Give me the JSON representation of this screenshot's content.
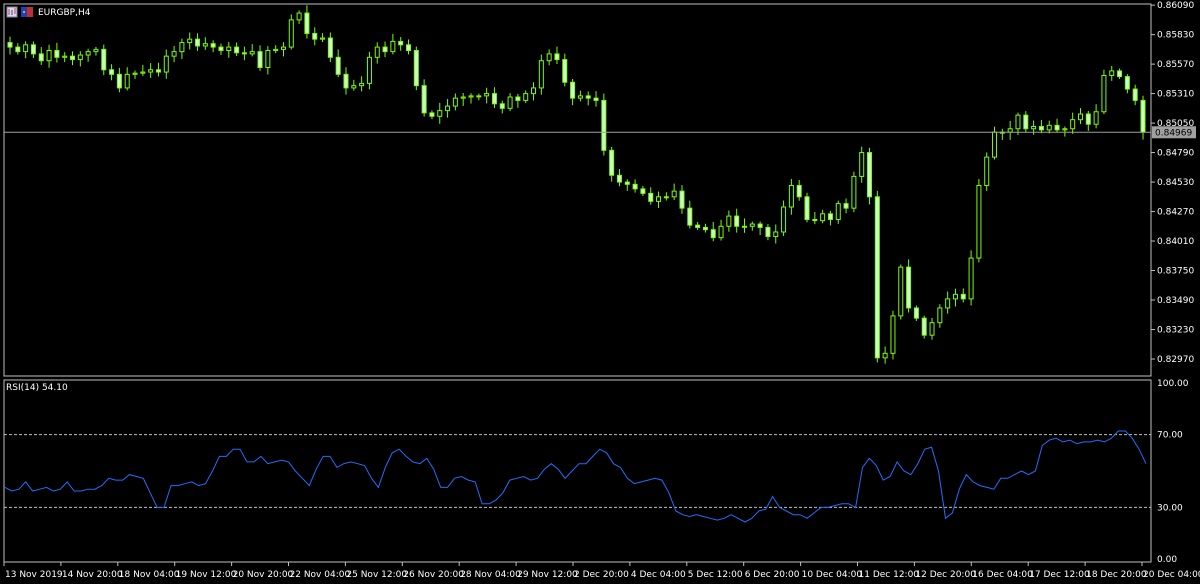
{
  "window": {
    "title": "EURGBP,H4",
    "icons": [
      "chart-window-icon",
      "eu-flag-icon"
    ]
  },
  "colors": {
    "background": "#000000",
    "frame": "#c0c0c0",
    "candle": "#7cfc00",
    "candle_body": "#ccffcc",
    "bid_line": "#a0a0a0",
    "rsi_line": "#1e6fff",
    "level_line": "#c0c0c0"
  },
  "chart_data": [
    {
      "type": "candlestick",
      "symbol": "EURGBP",
      "timeframe": "H4",
      "ylim": [
        0.8282,
        0.861
      ],
      "y_ticks": [
        "0.86090",
        "0.85830",
        "0.85570",
        "0.85310",
        "0.85050",
        "0.84790",
        "0.84530",
        "0.84270",
        "0.84010",
        "0.83750",
        "0.83490",
        "0.83230",
        "0.82970"
      ],
      "y_tick_values": [
        0.8609,
        0.8583,
        0.8557,
        0.8531,
        0.8505,
        0.8479,
        0.8453,
        0.8427,
        0.8401,
        0.8375,
        0.8349,
        0.8323,
        0.8297
      ],
      "current_price": 0.84969,
      "current_price_label": "0.84969",
      "close": [
        0.8572,
        0.8568,
        0.8574,
        0.8566,
        0.856,
        0.8569,
        0.8563,
        0.8564,
        0.8561,
        0.8565,
        0.8568,
        0.857,
        0.8552,
        0.8548,
        0.8536,
        0.8548,
        0.8549,
        0.855,
        0.8552,
        0.855,
        0.8564,
        0.8568,
        0.8576,
        0.8579,
        0.8573,
        0.8575,
        0.8572,
        0.8569,
        0.8572,
        0.8567,
        0.8566,
        0.8568,
        0.8554,
        0.8569,
        0.857,
        0.8572,
        0.8596,
        0.8602,
        0.8584,
        0.8579,
        0.858,
        0.8563,
        0.8548,
        0.8536,
        0.8538,
        0.854,
        0.8563,
        0.8572,
        0.8568,
        0.8577,
        0.8574,
        0.8569,
        0.8538,
        0.8514,
        0.8511,
        0.8516,
        0.852,
        0.8527,
        0.8528,
        0.8529,
        0.8529,
        0.8531,
        0.8522,
        0.8518,
        0.8528,
        0.8525,
        0.8531,
        0.8536,
        0.856,
        0.8566,
        0.8561,
        0.8541,
        0.8527,
        0.8529,
        0.8527,
        0.8525,
        0.8481,
        0.8459,
        0.8453,
        0.8451,
        0.8447,
        0.8443,
        0.8436,
        0.844,
        0.844,
        0.8445,
        0.843,
        0.8415,
        0.8413,
        0.8411,
        0.8404,
        0.8414,
        0.8423,
        0.8414,
        0.8414,
        0.8416,
        0.8413,
        0.8405,
        0.8409,
        0.8431,
        0.845,
        0.844,
        0.842,
        0.8419,
        0.8425,
        0.842,
        0.8434,
        0.843,
        0.8458,
        0.8479,
        0.844,
        0.8298,
        0.8302,
        0.8335,
        0.8378,
        0.8342,
        0.8333,
        0.8318,
        0.8329,
        0.8342,
        0.835,
        0.8354,
        0.835,
        0.8386,
        0.845,
        0.8475,
        0.8497,
        0.8497,
        0.85,
        0.8512,
        0.85,
        0.8502,
        0.8499,
        0.8503,
        0.8499,
        0.85,
        0.8508,
        0.8513,
        0.8504,
        0.8515,
        0.8547,
        0.8551,
        0.8546,
        0.8535,
        0.8525,
        0.8497
      ]
    },
    {
      "type": "line",
      "title": "RSI(14) 54.10",
      "ylim": [
        0,
        100
      ],
      "y_ticks": [
        "100.00",
        "70.00",
        "30.00",
        "0.00"
      ],
      "y_tick_values": [
        100,
        70,
        30,
        0
      ],
      "levels": [
        70,
        30
      ],
      "series": [
        {
          "name": "RSI(14)",
          "values": [
            41,
            39,
            40,
            44,
            39,
            40,
            41,
            39,
            40,
            44,
            39,
            39,
            40,
            40,
            42,
            46,
            45,
            45,
            48,
            47,
            46,
            38,
            30,
            30,
            42,
            42,
            43,
            44,
            42,
            43,
            50,
            58,
            58,
            62,
            62,
            55,
            55,
            58,
            54,
            55,
            56,
            55,
            50,
            46,
            42,
            51,
            58,
            58,
            52,
            54,
            55,
            54,
            53,
            46,
            41,
            52,
            60,
            62,
            58,
            55,
            54,
            57,
            51,
            41,
            41,
            46,
            47,
            45,
            44,
            32,
            32,
            34,
            38,
            45,
            46,
            47,
            45,
            46,
            51,
            54,
            51,
            46,
            50,
            54,
            54,
            58,
            62,
            60,
            54,
            52,
            46,
            43,
            44,
            45,
            46,
            45,
            38,
            28,
            26,
            25,
            26,
            25,
            24,
            23,
            24,
            26,
            24,
            22,
            24,
            28,
            29,
            36,
            30,
            28,
            26,
            26,
            24,
            27,
            30,
            30,
            31,
            32,
            32,
            30,
            52,
            57,
            53,
            45,
            47,
            55,
            50,
            48,
            54,
            62,
            63,
            50,
            24,
            27,
            40,
            48,
            44,
            42,
            41,
            40,
            46,
            46,
            48,
            50,
            48,
            50,
            64,
            67,
            68,
            66,
            67,
            65,
            66,
            66,
            67,
            66,
            68,
            72,
            72,
            68,
            62,
            54
          ]
        }
      ]
    }
  ],
  "x_axis": {
    "labels": [
      "13 Nov 2019",
      "14 Nov 20:00",
      "18 Nov 04:00",
      "19 Nov 12:00",
      "20 Nov 20:00",
      "22 Nov 04:00",
      "25 Nov 12:00",
      "26 Nov 20:00",
      "28 Nov 04:00",
      "29 Nov 12:00",
      "2 Dec 20:00",
      "4 Dec 04:00",
      "5 Dec 12:00",
      "6 Dec 20:00",
      "10 Dec 04:00",
      "11 Dec 12:00",
      "12 Dec 20:00",
      "16 Dec 04:00",
      "17 Dec 12:00",
      "18 Dec 20:00",
      "20 Dec 04:00"
    ]
  }
}
